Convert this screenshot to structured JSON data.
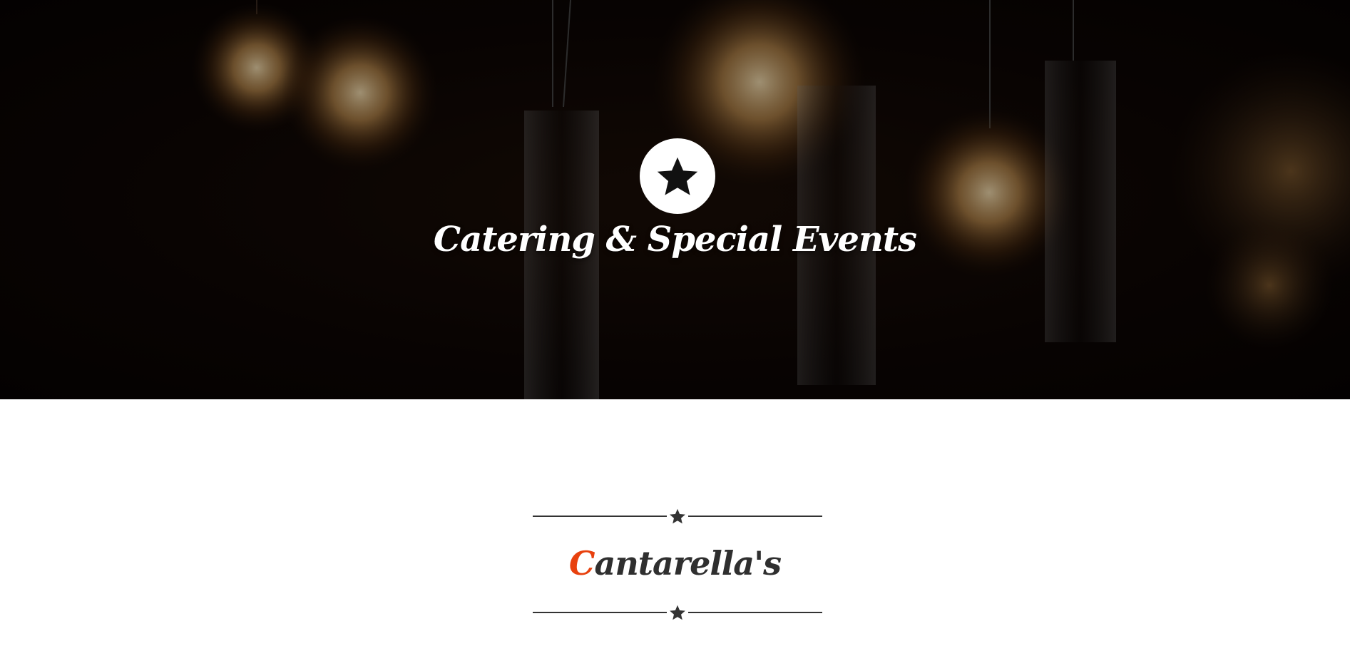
{
  "hero": {
    "title": "Catering & Special Events",
    "icon": "star-icon"
  },
  "section": {
    "brand_initial": "C",
    "brand_rest": "antarella's",
    "divider_icon": "star-icon"
  },
  "colors": {
    "accent": "#e8410e",
    "text_dark": "#2f2f2f",
    "hero_text": "#ffffff"
  }
}
